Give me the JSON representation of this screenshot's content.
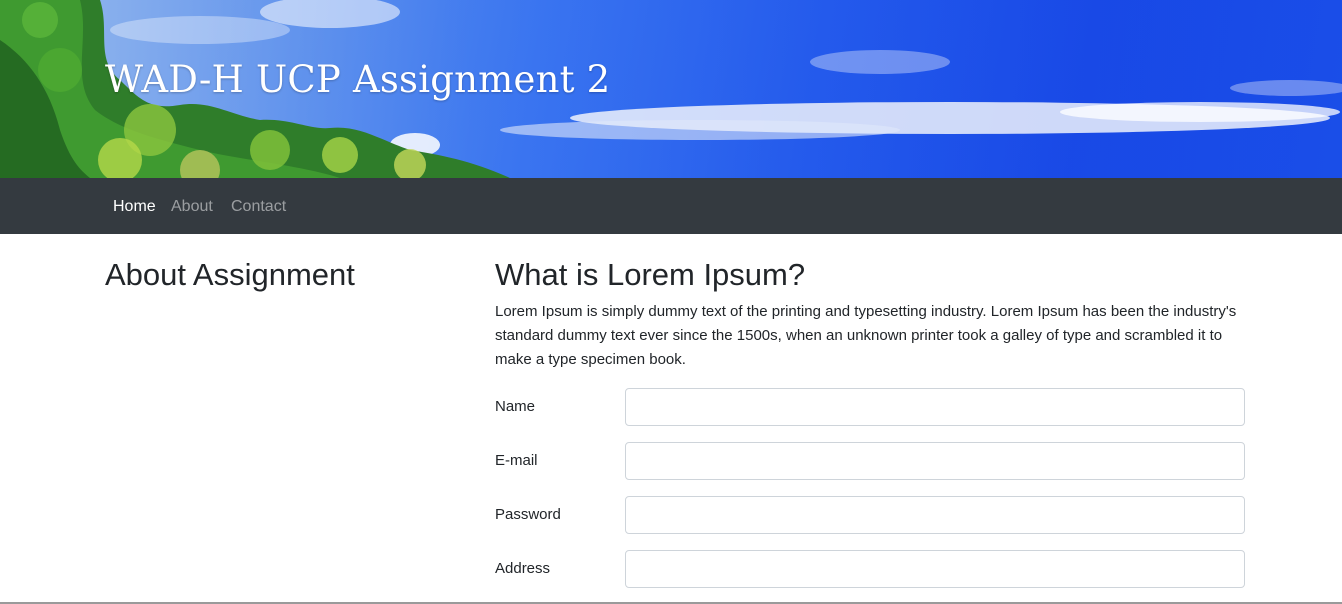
{
  "header": {
    "title": "WAD-H UCP Assignment 2"
  },
  "nav": {
    "items": [
      {
        "label": "Home",
        "active": true
      },
      {
        "label": "About",
        "active": false
      },
      {
        "label": "Contact",
        "active": false
      }
    ]
  },
  "sidebar": {
    "heading": "About Assignment"
  },
  "main": {
    "heading": "What is Lorem Ipsum?",
    "intro": "Lorem Ipsum is simply dummy text of the printing and typesetting industry. Lorem Ipsum has been the industry's standard dummy text ever since the 1500s, when an unknown printer took a galley of type and scrambled it to make a type specimen book.",
    "form": {
      "fields": [
        {
          "label": "Name",
          "value": "",
          "placeholder": ""
        },
        {
          "label": "E-mail",
          "value": "",
          "placeholder": ""
        },
        {
          "label": "Password",
          "value": "",
          "placeholder": ""
        },
        {
          "label": "Address",
          "value": "",
          "placeholder": ""
        }
      ]
    }
  },
  "colors": {
    "navbar_bg": "#343a40",
    "nav_active": "#ffffff",
    "nav_inactive": "#9a9da0",
    "sky": "#1e55ec"
  }
}
